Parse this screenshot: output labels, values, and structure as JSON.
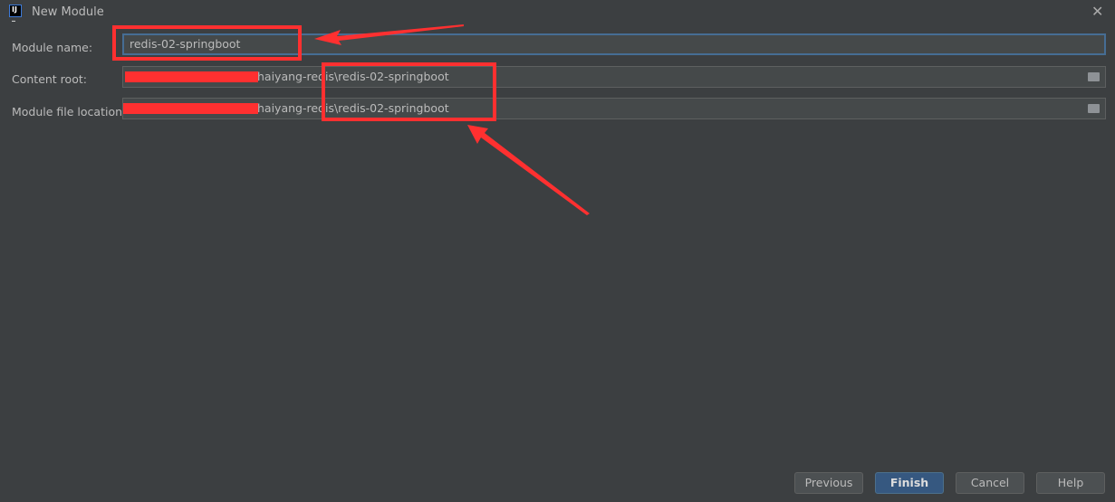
{
  "window": {
    "title": "New Module",
    "logo": "IJ",
    "close_icon": "close-icon"
  },
  "form": {
    "module_name": {
      "label": "Module name:",
      "value": "redis-02-springboot"
    },
    "content_root": {
      "label": "Content root:",
      "value": "haiyang-redis\\redis-02-springboot"
    },
    "module_file_location": {
      "label": "Module file location:",
      "value": "haiyang-redis\\redis-02-springboot"
    }
  },
  "buttons": {
    "previous": "Previous",
    "finish": "Finish",
    "cancel": "Cancel",
    "help": "Help"
  },
  "colors": {
    "annotation": "#ff3030",
    "accent": "#365880",
    "background": "#3c3f41"
  }
}
